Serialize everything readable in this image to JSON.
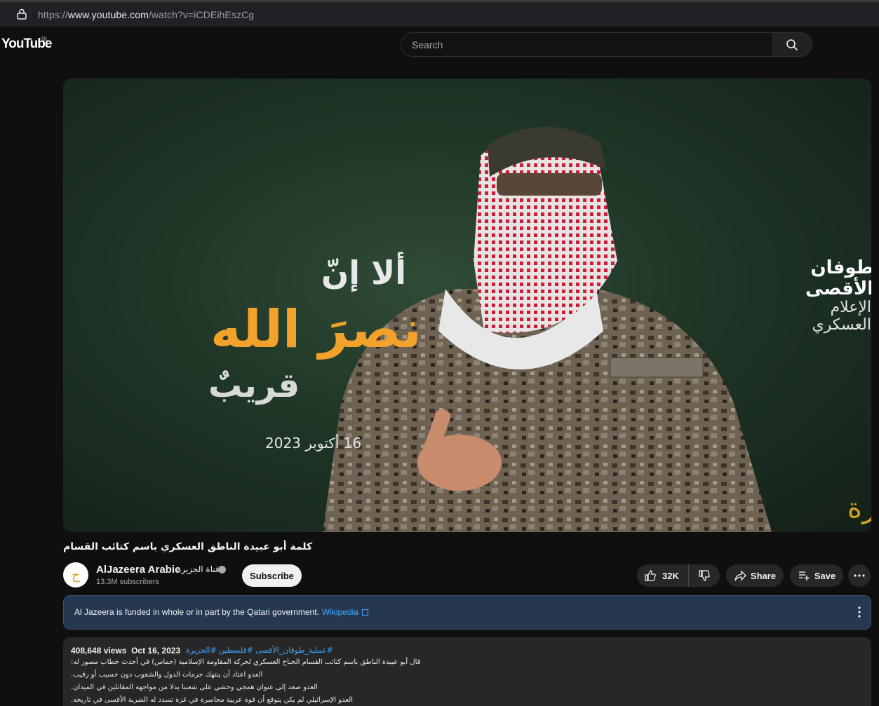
{
  "browser": {
    "url_prefix": "https://",
    "url_domain": "www.youtube.com",
    "url_path": "/watch?v=iCDEihEszCg"
  },
  "masthead": {
    "logo": "YouTube",
    "region": "NL",
    "search_placeholder": "Search"
  },
  "video": {
    "overlay_line1": "ألا إنّ",
    "overlay_line2": "نصرَ الله",
    "overlay_line3": "قريبٌ",
    "overlay_date": "16 أكتوبر 2023",
    "logo_main": "طوفان الأقصى",
    "logo_sub": "الإعلام العسكري",
    "watermark": "الجزيرة",
    "title": "كلمة أبو عبيدة الناطق العسكري باسم كتائب القسام"
  },
  "channel": {
    "name": "AlJazeera Arabic",
    "alt_name": "قناة الجزيرة",
    "subscribers": "13.3M subscribers",
    "avatar_glyph": "ج",
    "subscribe_label": "Subscribe"
  },
  "actions": {
    "likes": "32K",
    "share_label": "Share",
    "save_label": "Save"
  },
  "info_panel": {
    "text": "Al Jazeera is funded in whole or in part by the Qatari government.",
    "link": "Wikipedia"
  },
  "description": {
    "views": "408,648 views",
    "date": "Oct 16, 2023",
    "tags": "#عملية_طوفان_الأقصى #فلسطين #الجزيرة",
    "lines": [
      "قال أبو عبيدة الناطق باسم كتائب القسام الجناح العسكري لحركة المقاومة الإسلامية (حماس) في أحدث خطاب مصور له:",
      "العدو اعتاد أن ينتهك حرمات الدول والشعوب دون حسيب أو رقيب.",
      "العدو صعد إلى عنوان همجي وحشي على شعبنا بدلا من مواجهة المقاتلين في الميدان.",
      "العدو الإسرائيلي لم يكن يتوقع أن قوة عربية محاصرة في غزة تسدد له الضربة الأقسى في تاريخه."
    ]
  },
  "colors": {
    "background": "#0f0f0f",
    "accent_link": "#3ea6ff",
    "info_panel": "#263850",
    "overlay_orange": "#f2a22a"
  }
}
